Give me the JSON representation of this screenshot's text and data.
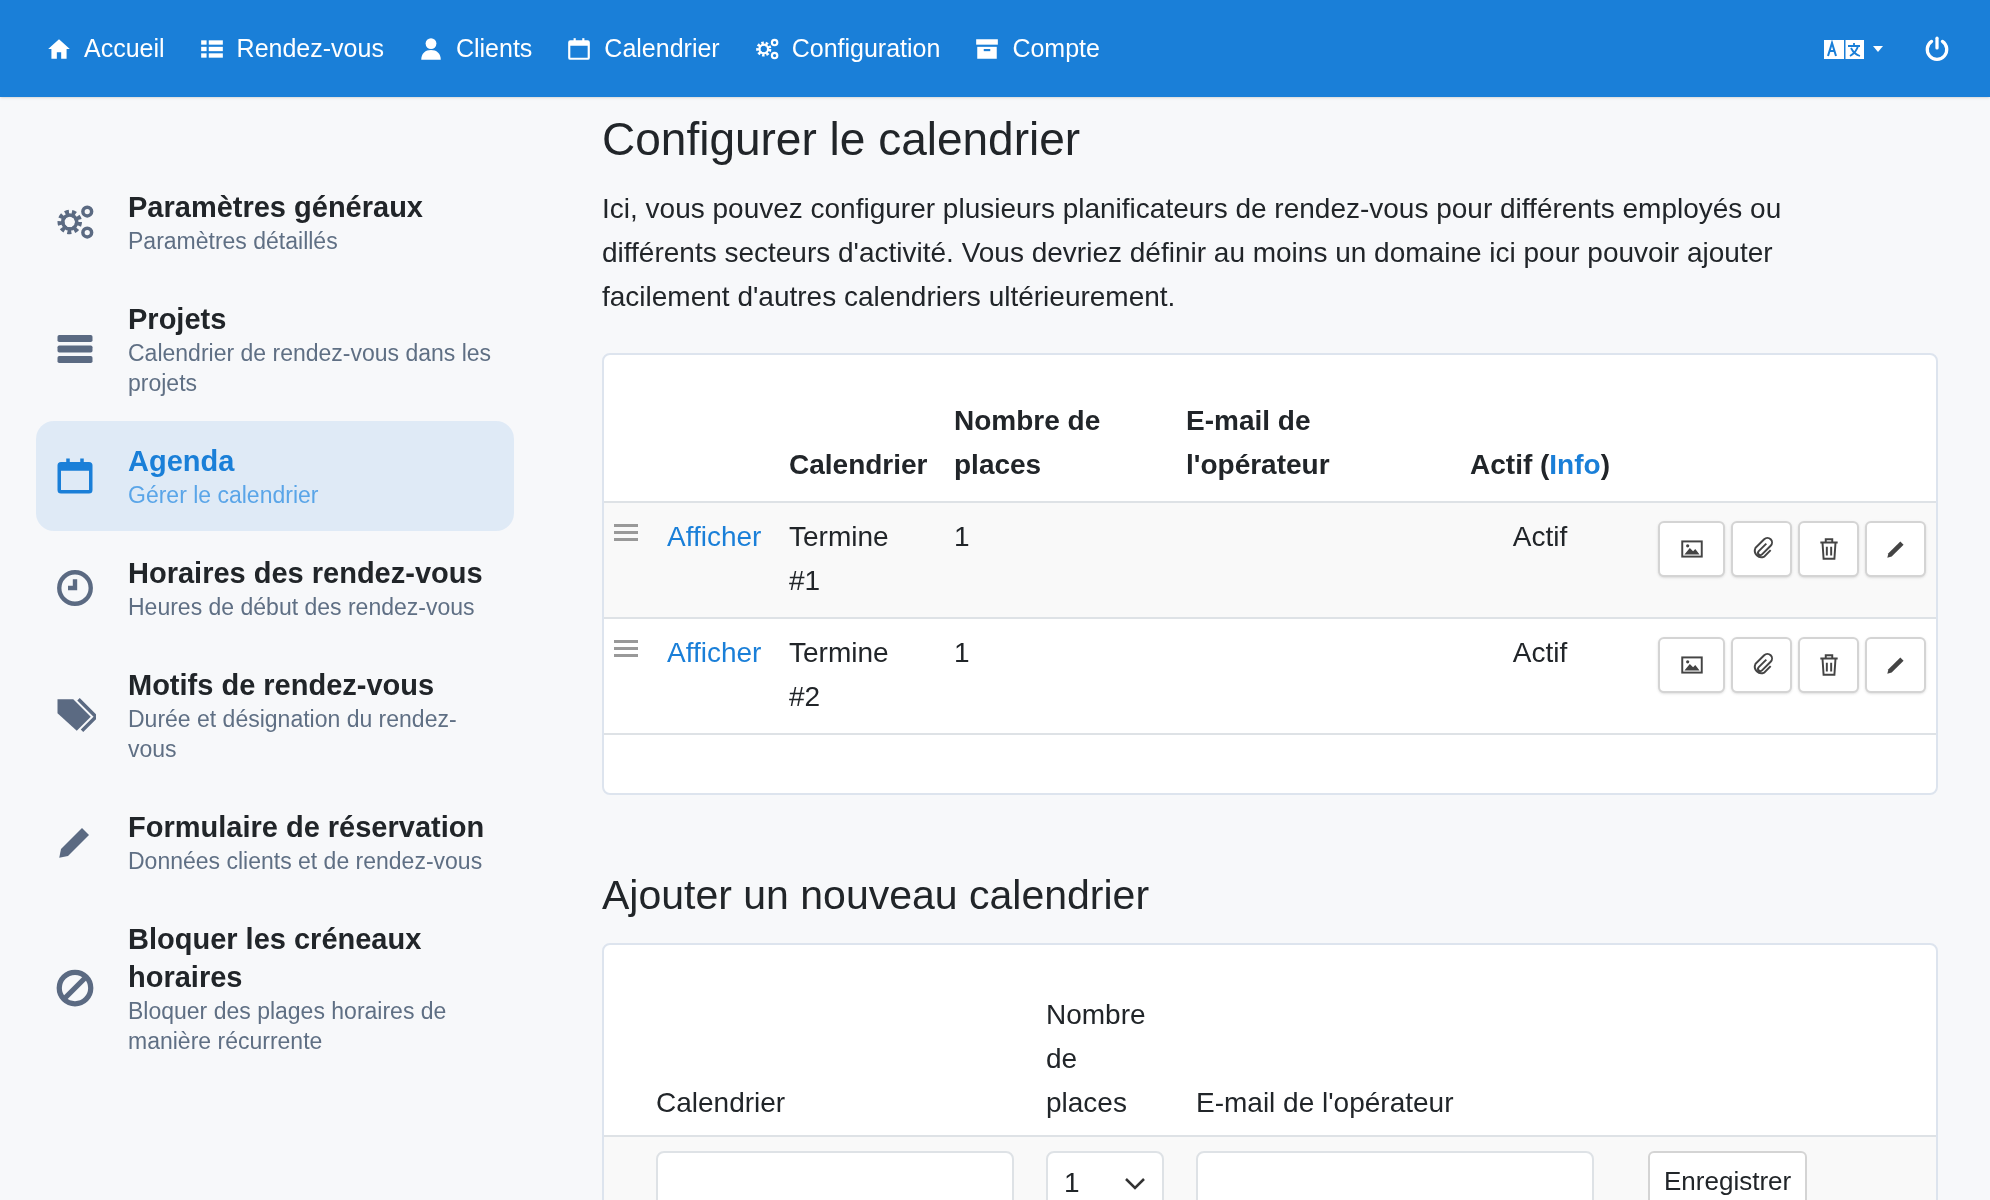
{
  "navbar": {
    "items": [
      {
        "label": "Accueil"
      },
      {
        "label": "Rendez-vous"
      },
      {
        "label": "Clients"
      },
      {
        "label": "Calendrier"
      },
      {
        "label": "Configuration"
      },
      {
        "label": "Compte"
      }
    ]
  },
  "sidebar": {
    "items": [
      {
        "title": "Paramètres généraux",
        "subtitle": "Paramètres détaillés",
        "selected": false
      },
      {
        "title": "Projets",
        "subtitle": "Calendrier de rendez-vous dans les projets",
        "selected": false
      },
      {
        "title": "Agenda",
        "subtitle": "Gérer le calendrier",
        "selected": true
      },
      {
        "title": "Horaires des rendez-vous",
        "subtitle": "Heures de début des rendez-vous",
        "selected": false
      },
      {
        "title": "Motifs de rendez-vous",
        "subtitle": "Durée et désignation du rendez-vous",
        "selected": false
      },
      {
        "title": "Formulaire de réservation",
        "subtitle": "Données clients et de rendez-vous",
        "selected": false
      },
      {
        "title": "Bloquer les créneaux horaires",
        "subtitle": "Bloquer des plages horaires de manière récurrente",
        "selected": false
      }
    ]
  },
  "main": {
    "title": "Configurer le calendrier",
    "intro": "Ici, vous pouvez configurer plusieurs planificateurs de rendez-vous pour différents employés ou différents secteurs d'activité. Vous devriez définir au moins un domaine ici pour pouvoir ajouter facilement d'autres calendriers ultérieurement.",
    "table": {
      "columns": [
        "Calendrier",
        "Nombre de places",
        "E-mail de l'opérateur"
      ],
      "status_column": {
        "label": "Actif (",
        "link": "Info",
        "suffix": ")"
      },
      "rows": [
        {
          "link": "Afficher",
          "calendar": "Termine #1",
          "places": "1",
          "status": "Actif"
        },
        {
          "link": "Afficher",
          "calendar": "Termine #2",
          "places": "1",
          "status": "Actif"
        }
      ]
    },
    "add_section": {
      "title": "Ajouter un nouveau calendrier",
      "columns": [
        "Calendrier",
        "Nombre de places",
        "E-mail de l'opérateur"
      ],
      "places_value": "1",
      "submit": "Enregistrer"
    }
  }
}
